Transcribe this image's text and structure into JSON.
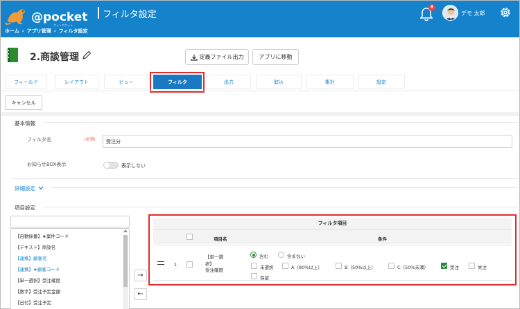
{
  "header": {
    "logo_text": "@pocket",
    "logo_sub": "アットポケット",
    "title": "フィルタ設定",
    "notification_count": "8",
    "user_name": "デモ 太郎",
    "icons": [
      "bell-icon",
      "avatar",
      "gear-icon"
    ]
  },
  "breadcrumb": [
    "ホーム",
    "アプリ管理",
    "フィルタ設定"
  ],
  "app": {
    "title": "2.商談管理",
    "export_button": "定義ファイル出力",
    "move_button": "アプリに移動"
  },
  "tabs": [
    {
      "label": "フィールド",
      "active": false
    },
    {
      "label": "レイアウト",
      "active": false
    },
    {
      "label": "ビュー",
      "active": false
    },
    {
      "label": "フィルタ",
      "active": true
    },
    {
      "label": "出力",
      "active": false
    },
    {
      "label": "取込",
      "active": false
    },
    {
      "label": "集計",
      "active": false
    },
    {
      "label": "設定",
      "active": false
    }
  ],
  "cancel_button": "キャンセル",
  "basic_info": {
    "section_title": "基本情報",
    "filter_name_label": "フィルタ名",
    "required_mark": "[必須]",
    "filter_name_value": "受注分",
    "notice_label": "お知らせBOX表示",
    "toggle_label": "表示しない",
    "toggle_on": false
  },
  "detail_settings": "詳細設定",
  "item_settings": {
    "section_title": "項目設定",
    "list": [
      {
        "label": "【自動採番】★案件コード",
        "linked": false
      },
      {
        "label": "【テキスト】商談名",
        "linked": false
      },
      {
        "label": "【連携】顧客名",
        "linked": true
      },
      {
        "label": "【連携】★顧客コード",
        "linked": true
      },
      {
        "label": "【単一選択】受注確度",
        "linked": false
      },
      {
        "label": "【数字】受注予定金額",
        "linked": false
      },
      {
        "label": "【日付】受注予定",
        "linked": false
      }
    ],
    "move_right": "→",
    "move_left": "←"
  },
  "filter_table": {
    "title": "フィルタ項目",
    "col_item": "項目名",
    "col_condition": "条件",
    "rows": [
      {
        "number": "1",
        "item_name_lines": [
          "【単一選",
          "択】",
          "受注確度"
        ],
        "match_options": [
          {
            "label": "含む",
            "selected": true
          },
          {
            "label": "含まない",
            "selected": false
          }
        ],
        "values": [
          {
            "label": "未選択",
            "checked": false
          },
          {
            "label": "A（80%以上）",
            "checked": false
          },
          {
            "label": "B（50%以上）",
            "checked": false
          },
          {
            "label": "C（50%未満）",
            "checked": false
          },
          {
            "label": "受注",
            "checked": true
          },
          {
            "label": "失注",
            "checked": false
          },
          {
            "label": "保留",
            "checked": false
          }
        ]
      }
    ]
  },
  "colors": {
    "header_bg": "#1583cc",
    "active_tab": "#1a79c3",
    "highlight": "#e52a2a",
    "check_green": "#2b8a3e"
  }
}
